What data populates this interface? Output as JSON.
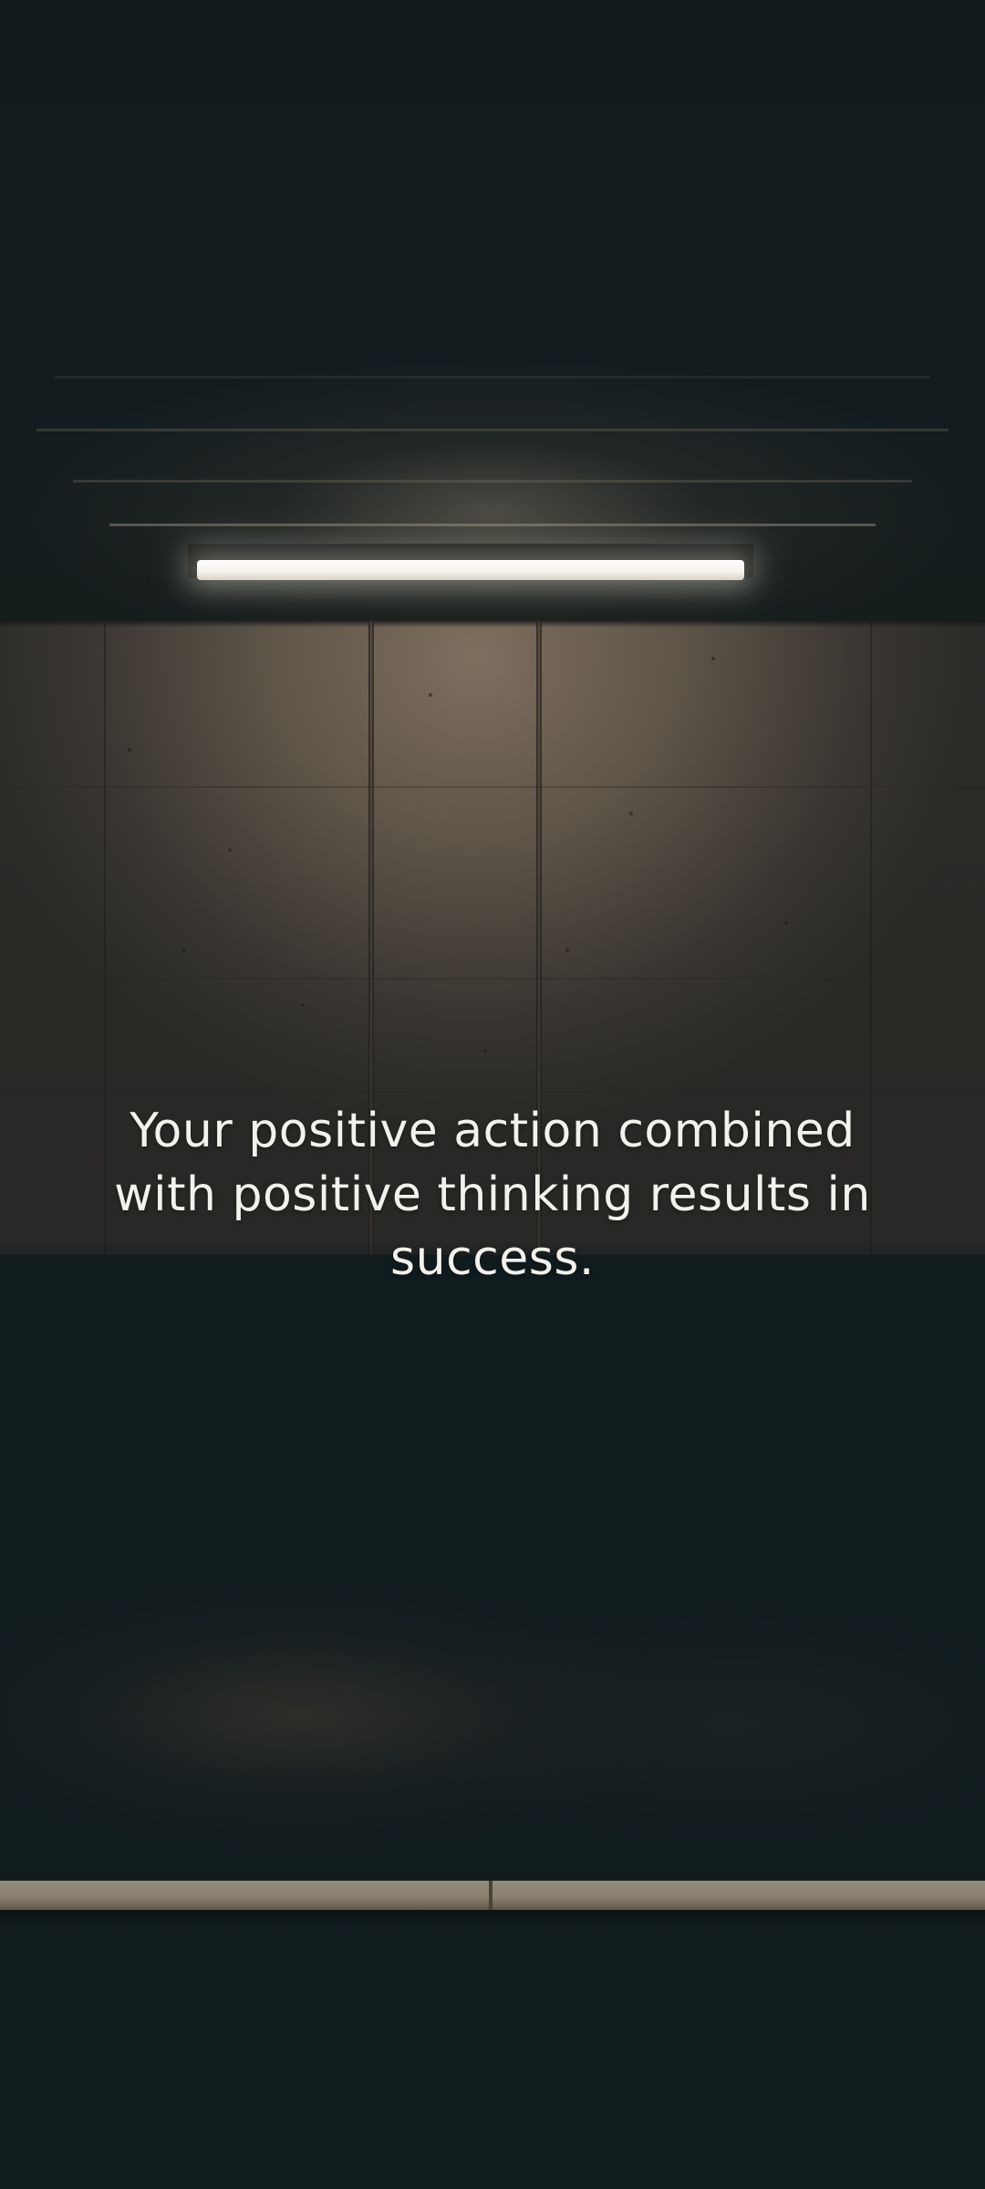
{
  "quote": {
    "text": "Your positive action combined with positive thinking results in success."
  },
  "colors": {
    "background": "#111c1f",
    "quote_text": "#f3f1ec",
    "wall": "#5a5248",
    "curb": "#968a78",
    "light": "#ffffff"
  }
}
